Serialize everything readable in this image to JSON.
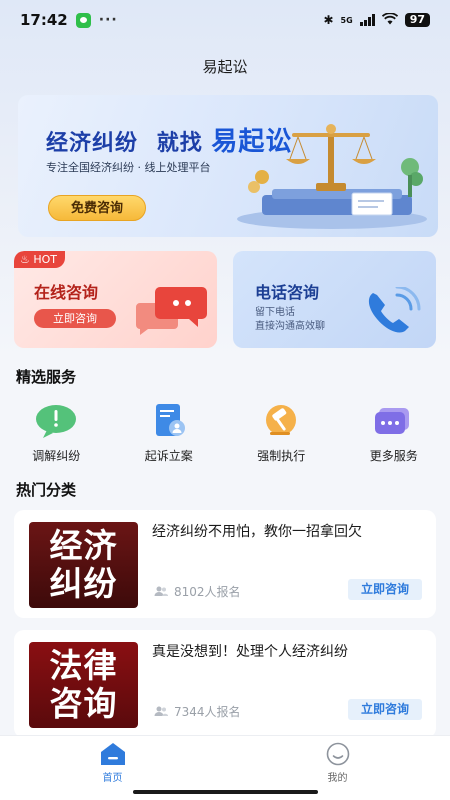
{
  "status_bar": {
    "time": "17:42",
    "dots": "···",
    "network": "5G",
    "battery": "97"
  },
  "header": {
    "title": "易起讼"
  },
  "banner": {
    "headline_prefix": "经济纠纷",
    "headline_mid": "就找",
    "headline_brand": "易起讼",
    "subtitle": "专注全国经济纠纷 · 线上处理平台",
    "button": "免费咨询"
  },
  "quick_cards": {
    "online": {
      "tag": "HOT",
      "title": "在线咨询",
      "button": "立即咨询"
    },
    "phone": {
      "title": "电话咨询",
      "line1": "留下电话",
      "line2": "直接沟通高效聊"
    }
  },
  "services": {
    "title": "精选服务",
    "items": [
      {
        "label": "调解纠纷",
        "icon": "chat-alert-icon"
      },
      {
        "label": "起诉立案",
        "icon": "document-user-icon"
      },
      {
        "label": "强制执行",
        "icon": "gavel-icon"
      },
      {
        "label": "更多服务",
        "icon": "more-chat-icon"
      }
    ]
  },
  "hot": {
    "title": "热门分类",
    "items": [
      {
        "thumb_line1": "经济",
        "thumb_line2": "纠纷",
        "title": "经济纠纷不用怕，教你一招拿回欠",
        "meta": "8102人报名",
        "button": "立即咨询"
      },
      {
        "thumb_line1": "法律",
        "thumb_line2": "咨询",
        "title": "真是没想到！处理个人经济纠纷",
        "meta": "7344人报名",
        "button": "立即咨询"
      }
    ]
  },
  "tabbar": {
    "items": [
      {
        "label": "首页",
        "active": true
      },
      {
        "label": "我的",
        "active": false
      }
    ]
  },
  "colors": {
    "accent": "#2f7bdc",
    "hot": "#e8453c",
    "brand_blue": "#1a56d6",
    "gold": "#f6b93a"
  }
}
